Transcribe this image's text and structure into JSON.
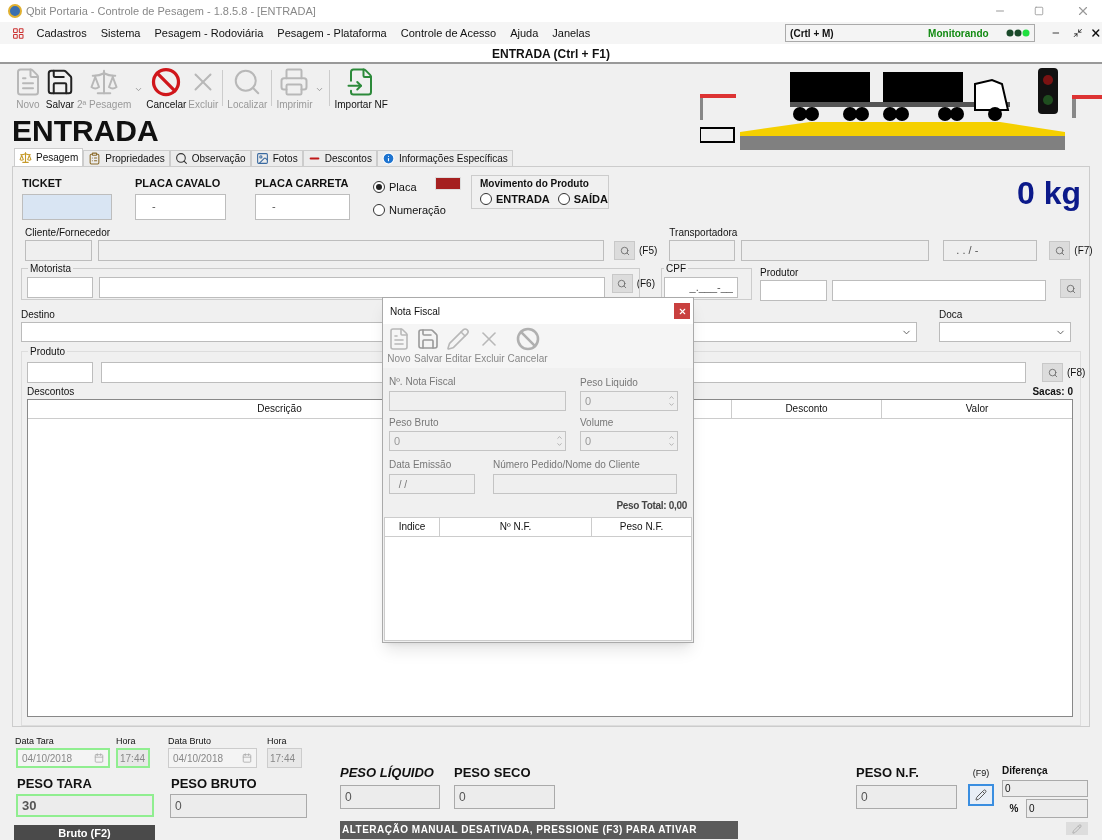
{
  "window": {
    "title": "Qbit Portaria - Controle de Pesagem - 1.8.5.8 - [ENTRADA]"
  },
  "menu": [
    "Cadastros",
    "Sistema",
    "Pesagem - Rodoviária",
    "Pesagem - Plataforma",
    "Controle de Acesso",
    "Ajuda",
    "Janelas"
  ],
  "monitor": {
    "shortcut": "(Crtl + M)",
    "status": "Monitorando"
  },
  "screen_title": "ENTRADA (Ctrl + F1)",
  "toolbar": [
    {
      "label": "Novo",
      "kind": "new",
      "disabled": true,
      "dropdown": false
    },
    {
      "label": "Salvar",
      "kind": "save",
      "disabled": false,
      "dropdown": false
    },
    {
      "label": "2ª Pesagem",
      "kind": "scale",
      "disabled": true,
      "dropdown": true
    },
    {
      "label": "Cancelar",
      "kind": "cancel",
      "disabled": false,
      "dropdown": false
    },
    {
      "label": "Excluir",
      "kind": "delete",
      "disabled": true,
      "dropdown": false
    },
    {
      "label": "Localizar",
      "kind": "find",
      "disabled": true,
      "dropdown": false
    },
    {
      "label": "Imprimir",
      "kind": "print",
      "disabled": true,
      "dropdown": true
    },
    {
      "label": "Importar NF",
      "kind": "import",
      "disabled": false,
      "dropdown": false
    }
  ],
  "mode_title": "ENTRADA",
  "tabs": [
    {
      "label": "Pesagem",
      "kind": "scale",
      "selected": true
    },
    {
      "label": "Propriedades",
      "kind": "properties",
      "selected": false
    },
    {
      "label": "Observação",
      "kind": "search",
      "selected": false
    },
    {
      "label": "Fotos",
      "kind": "photo",
      "selected": false
    },
    {
      "label": "Descontos",
      "kind": "minus",
      "selected": false
    },
    {
      "label": "Informações Específicas",
      "kind": "info",
      "selected": false
    }
  ],
  "form": {
    "ticket": {
      "label": "TICKET"
    },
    "placa_cavalo": {
      "label": "PLACA CAVALO",
      "value": "-"
    },
    "placa_carreta": {
      "label": "PLACA CARRETA",
      "value": "-"
    },
    "plate_type": [
      {
        "label": "Placa",
        "selected": true
      },
      {
        "label": "Numeração",
        "selected": false
      }
    ],
    "movimento": {
      "title": "Movimento do Produto",
      "options": [
        {
          "label": "ENTRADA",
          "selected": false
        },
        {
          "label": "SAÍDA",
          "selected": false
        }
      ]
    },
    "weight": "0 kg",
    "cliente": {
      "label": "Cliente/Fornecedor",
      "shortcut": "(F5)"
    },
    "transportadora": {
      "label": "Transportadora",
      "document": ". . /  -",
      "shortcut": "(F7)"
    },
    "motorista": {
      "label": "Motorista",
      "shortcut": "(F6)"
    },
    "cpf": {
      "label": "CPF",
      "value": "_.___-__"
    },
    "produtor": {
      "label": "Produtor"
    },
    "destino": {
      "label": "Destino"
    },
    "doca": {
      "label": "Doca"
    },
    "produto": {
      "label": "Produto",
      "shortcut": "(F8)"
    },
    "descontos": {
      "label": "Descontos",
      "sacas": "Sacas: 0",
      "columns": [
        "Descrição",
        "Desconto",
        "Valor"
      ]
    }
  },
  "bottom": {
    "data_tara": {
      "label": "Data Tara",
      "value": "04/10/2018"
    },
    "hora_tara": {
      "label": "Hora",
      "value": "17:44"
    },
    "data_bruto": {
      "label": "Data Bruto",
      "value": "04/10/2018"
    },
    "hora_bruto": {
      "label": "Hora",
      "value": "17:44"
    },
    "peso_tara": {
      "label": "PESO TARA",
      "value": "30"
    },
    "peso_bruto": {
      "label": "PESO BRUTO",
      "value": "0"
    },
    "peso_liquido": {
      "label": "PESO LÍQUIDO",
      "value": "0"
    },
    "peso_seco": {
      "label": "PESO SECO",
      "value": "0"
    },
    "peso_nf": {
      "label": "PESO N.F.",
      "value": "0",
      "shortcut": "(F9)"
    },
    "diferenca": {
      "label": "Diferença",
      "value": "0",
      "percent_label": "%",
      "percent": "0"
    },
    "bruto_button": "Bruto (F2)",
    "manual_banner": "ALTERAÇÃO MANUAL DESATIVADA, PRESSIONE (F3) PARA ATIVAR"
  },
  "dialog": {
    "title": "Nota Fiscal",
    "toolbar": [
      {
        "label": "Novo",
        "kind": "new",
        "disabled": true
      },
      {
        "label": "Salvar",
        "kind": "save",
        "disabled": true
      },
      {
        "label": "Editar",
        "kind": "edit",
        "disabled": true
      },
      {
        "label": "Excluir",
        "kind": "delete",
        "disabled": true
      },
      {
        "label": "Cancelar",
        "kind": "cancel",
        "disabled": true
      }
    ],
    "nota_fiscal": {
      "label": "Nº. Nota Fiscal"
    },
    "peso_liquido": {
      "label": "Peso Liquido",
      "value": "0"
    },
    "peso_bruto": {
      "label": "Peso Bruto",
      "value": "0"
    },
    "volume": {
      "label": "Volume",
      "value": "0"
    },
    "data_emissao": {
      "label": "Data Emissão",
      "value": " / /"
    },
    "pedido": {
      "label": "Número Pedido/Nome do Cliente"
    },
    "peso_total": "Peso Total: 0,00",
    "columns": [
      "Indice",
      "Nº N.F.",
      "Peso N.F."
    ]
  }
}
